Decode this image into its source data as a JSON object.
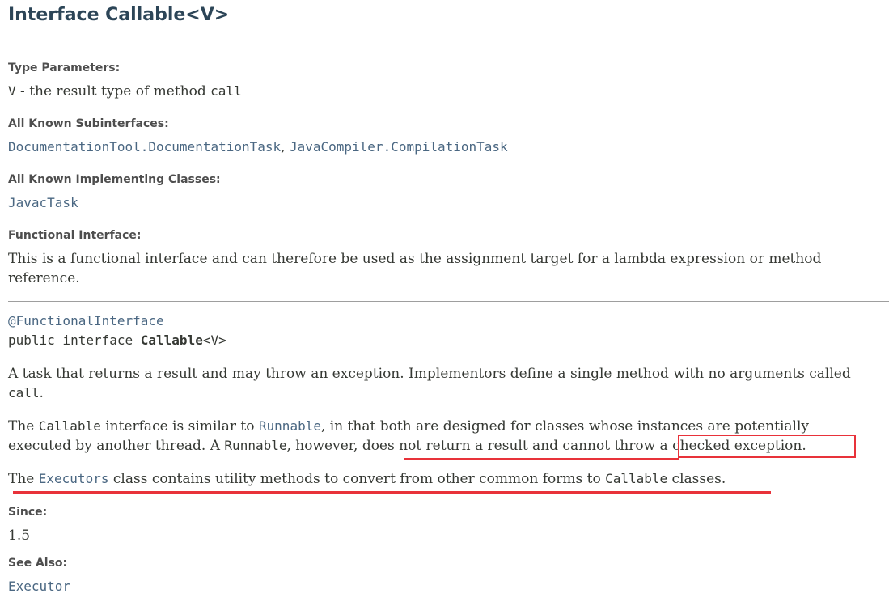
{
  "title": "Interface Callable<V>",
  "type_params": {
    "heading": "Type Parameters:",
    "param": "V",
    "sep": " - the result type of method ",
    "method": "call"
  },
  "subinterfaces": {
    "heading": "All Known Subinterfaces:",
    "item1": "DocumentationTool.DocumentationTask",
    "sep": ", ",
    "item2": "JavaCompiler.CompilationTask"
  },
  "implementing": {
    "heading": "All Known Implementing Classes:",
    "item1": "JavacTask"
  },
  "functional": {
    "heading": "Functional Interface:",
    "text": "This is a functional interface and can therefore be used as the assignment target for a lambda expression or method reference."
  },
  "signature": {
    "annotation": "@FunctionalInterface",
    "prefix": "public interface ",
    "name": "Callable",
    "generic": "<V>"
  },
  "description": {
    "p1_text": "A task that returns a result and may throw an exception. Implementors define a single method with no arguments called ",
    "p1_code": "call",
    "p1_end": ".",
    "p2_a": "The ",
    "p2_code1": "Callable",
    "p2_b": " interface is similar to ",
    "p2_link1": "Runnable",
    "p2_c": ", in that both are designed for classes whose instances are potentially executed by another thread. A ",
    "p2_code2": "Runnable",
    "p2_d": ", however, does not return a result and cannot throw a checked exception.",
    "p3_a": "The ",
    "p3_link": "Executors",
    "p3_b": " class contains utility methods to convert from other common forms to ",
    "p3_code": "Callable",
    "p3_c": " classes."
  },
  "since": {
    "heading": "Since:",
    "value": "1.5"
  },
  "see_also": {
    "heading": "See Also:",
    "link": "Executor"
  },
  "annotation_color": "#e8323a"
}
